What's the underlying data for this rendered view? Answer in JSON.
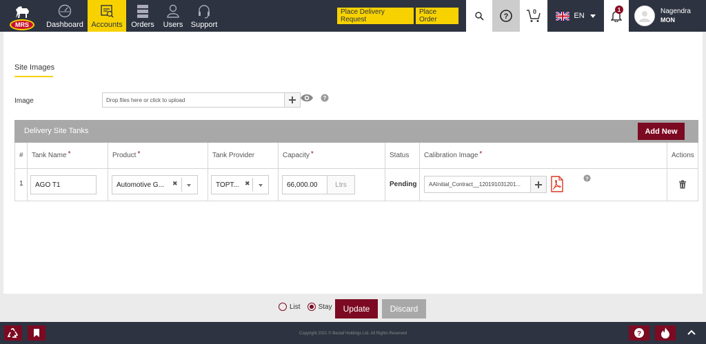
{
  "logo": {
    "text": "MRS"
  },
  "nav": {
    "items": [
      {
        "label": "Dashboard"
      },
      {
        "label": "Accounts"
      },
      {
        "label": "Orders"
      },
      {
        "label": "Users"
      },
      {
        "label": "Support"
      }
    ],
    "active": "Accounts"
  },
  "header": {
    "place_delivery_request": "Place Delivery Request",
    "place_order": "Place Order",
    "cart_count": "0",
    "language": "EN",
    "notification_count": "1",
    "user_name": "Nagendra",
    "user_sub": "MON"
  },
  "site_images": {
    "title": "Site Images",
    "image_label": "Image",
    "dropzone_text": "Drop files here or click to upload"
  },
  "tanks": {
    "title": "Delivery Site Tanks",
    "add_new": "Add New",
    "columns": {
      "num": "#",
      "tank_name": "Tank Name",
      "product": "Product",
      "tank_provider": "Tank Provider",
      "capacity": "Capacity",
      "status": "Status",
      "calibration_image": "Calibration Image",
      "actions": "Actions"
    },
    "rows": [
      {
        "num": "1",
        "tank_name": "AGO T1",
        "product": "Automotive G...",
        "tank_provider": "TOPT...",
        "capacity": "66,000.00",
        "unit": "Ltrs",
        "status": "Pending",
        "calibration_file": "AAInitial_Contract__120191031201..."
      }
    ]
  },
  "form": {
    "mode_list": "List",
    "mode_stay": "Stay",
    "selected_mode": "Stay",
    "update": "Update",
    "discard": "Discard"
  },
  "footer": {
    "copyright": "Copyright 2021 © Bestaf Holdings Ltd. All Rights Reserved"
  },
  "colors": {
    "nav_bg": "#2d3340",
    "accent_yellow": "#f7d200",
    "primary_maroon": "#7c0a22",
    "panel_gray": "#a8a8a8"
  }
}
